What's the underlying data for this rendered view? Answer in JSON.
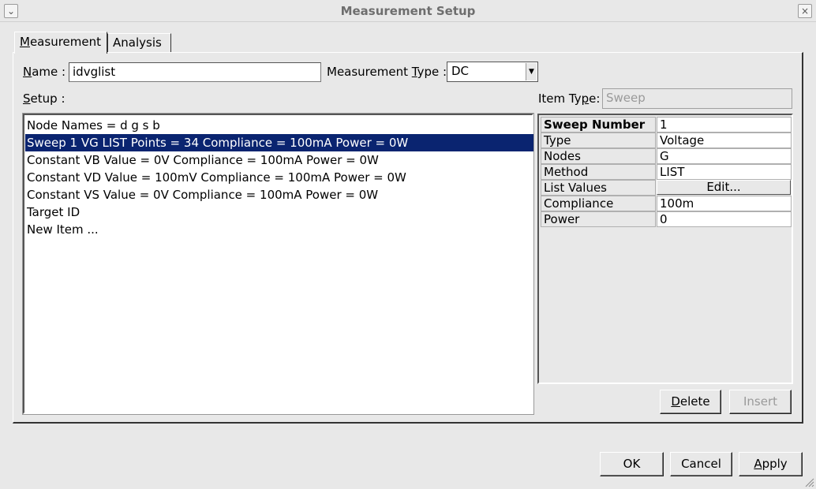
{
  "window": {
    "title": "Measurement Setup",
    "menu_icon": "chevron-down-icon",
    "close_icon": "close-icon"
  },
  "tabs": [
    {
      "label": "Measurement",
      "mnemonic": "M",
      "rest": "easurement",
      "active": true
    },
    {
      "label": "Analysis",
      "mnemonic": "",
      "rest": "Analysis",
      "active": false
    }
  ],
  "form": {
    "name_label_m": "N",
    "name_label_rest": "ame :",
    "name_value": "idvglist",
    "type_label_pre": "Measurement ",
    "type_label_m": "T",
    "type_label_rest": "ype :",
    "type_value": "DC",
    "setup_label_m": "S",
    "setup_label_rest": "etup :",
    "item_type_label": "Item Type:",
    "item_type_label_pre": "Item Ty",
    "item_type_label_m": "p",
    "item_type_label_rest": "e:",
    "item_type_value": "Sweep"
  },
  "setup_items": [
    {
      "text": "Node Names = d g s b",
      "selected": false
    },
    {
      "text": "Sweep 1 VG LIST Points = 34 Compliance = 100mA Power = 0W",
      "selected": true
    },
    {
      "text": "Constant VB Value = 0V Compliance = 100mA Power = 0W",
      "selected": false
    },
    {
      "text": "Constant VD Value = 100mV Compliance = 100mA Power = 0W",
      "selected": false
    },
    {
      "text": "Constant VS Value = 0V Compliance = 100mA Power = 0W",
      "selected": false
    },
    {
      "text": "Target ID",
      "selected": false
    },
    {
      "text": "New Item ...",
      "selected": false
    }
  ],
  "properties": [
    {
      "key": "Sweep Number",
      "value": "1",
      "bold": true
    },
    {
      "key": "Type",
      "value": "Voltage"
    },
    {
      "key": "Nodes",
      "value": "G"
    },
    {
      "key": "Method",
      "value": "LIST"
    },
    {
      "key": "List Values",
      "button": "Edit..."
    },
    {
      "key": "Compliance",
      "value": "100m"
    },
    {
      "key": "Power",
      "value": "0"
    }
  ],
  "buttons": {
    "delete_m": "D",
    "delete_rest": "elete",
    "insert": "Insert",
    "ok": "OK",
    "cancel": "Cancel",
    "apply_m": "A",
    "apply_rest": "pply"
  },
  "colors": {
    "selection": "#0a2470",
    "background": "#e8e8e8"
  }
}
